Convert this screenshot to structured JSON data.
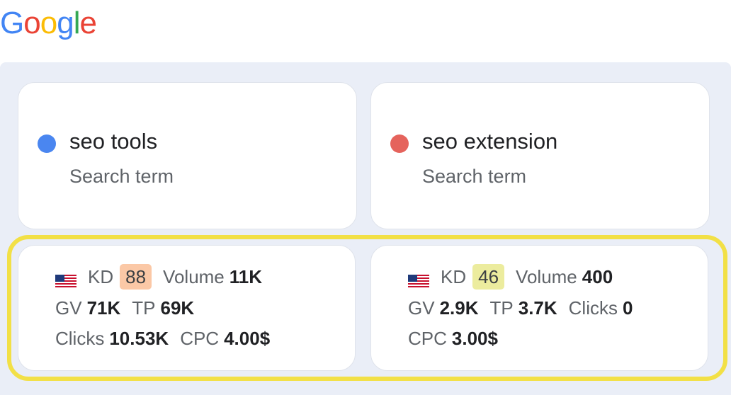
{
  "logo": {
    "letters": [
      "G",
      "o",
      "o",
      "g",
      "l",
      "e"
    ],
    "colors": [
      "#4285F4",
      "#EA4335",
      "#FBBC05",
      "#4285F4",
      "#34A853",
      "#EA4335"
    ]
  },
  "terms": [
    {
      "title": "seo tools",
      "subtitle": "Search term",
      "dot_color": "#4a86f0"
    },
    {
      "title": "seo extension",
      "subtitle": "Search term",
      "dot_color": "#e5635c"
    }
  ],
  "metrics": [
    {
      "flag": "us-flag-icon",
      "kd_label": "KD",
      "kd_value": "88",
      "kd_color": "#fbc8a6",
      "volume_label": "Volume",
      "volume_value": "11K",
      "gv_label": "GV",
      "gv_value": "71K",
      "tp_label": "TP",
      "tp_value": "69K",
      "clicks_label": "Clicks",
      "clicks_value": "10.53K",
      "cpc_label": "CPC",
      "cpc_value": "4.00$"
    },
    {
      "flag": "us-flag-icon",
      "kd_label": "KD",
      "kd_value": "46",
      "kd_color": "#ecec9e",
      "volume_label": "Volume",
      "volume_value": "400",
      "gv_label": "GV",
      "gv_value": "2.9K",
      "tp_label": "TP",
      "tp_value": "3.7K",
      "clicks_label": "Clicks",
      "clicks_value": "0",
      "cpc_label": "CPC",
      "cpc_value": "3.00$"
    }
  ],
  "highlight_color": "#f2e046"
}
